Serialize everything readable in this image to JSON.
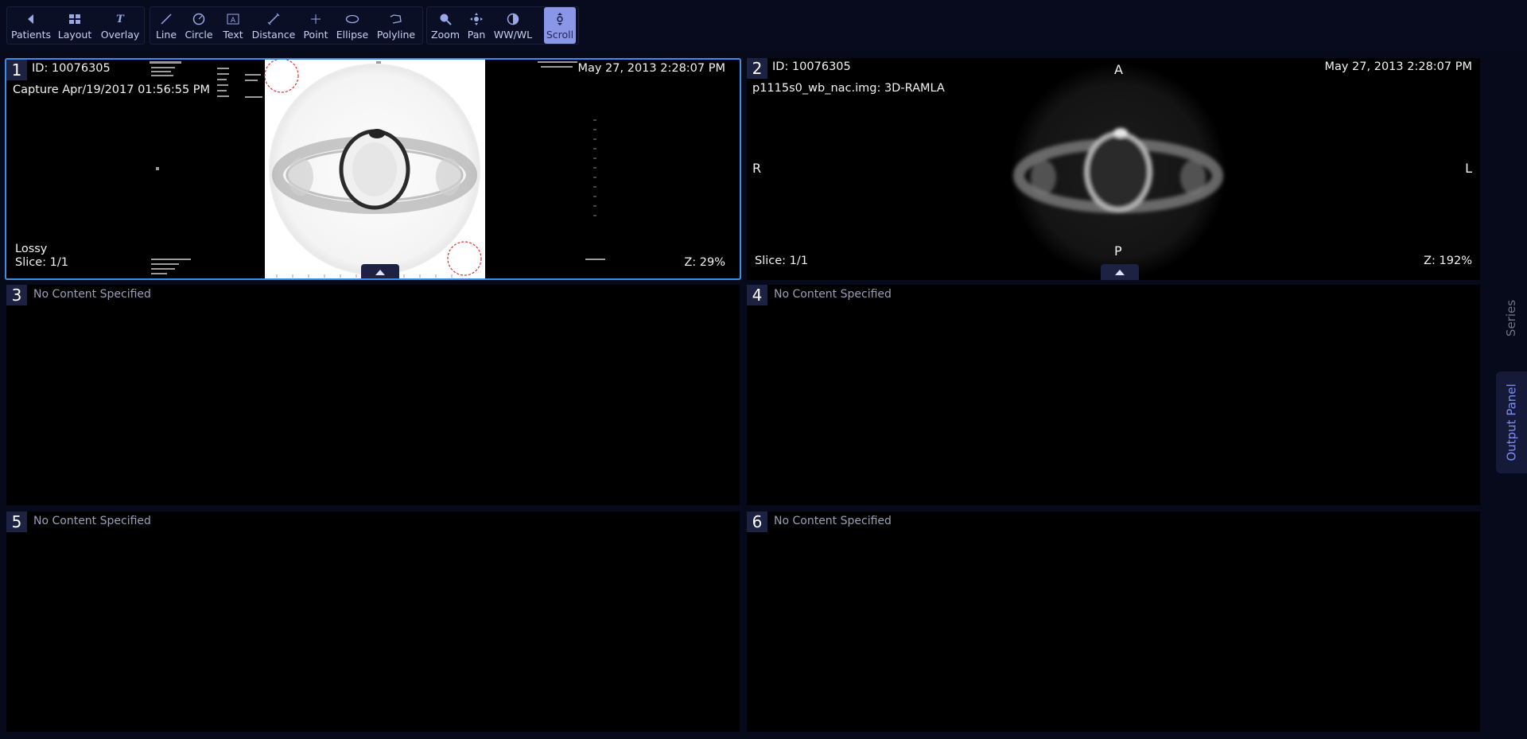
{
  "toolbar": {
    "nav": [
      {
        "label": "Patients",
        "icon": "chevron-left-icon"
      },
      {
        "label": "Layout",
        "icon": "grid-layout-icon"
      },
      {
        "label": "Overlay",
        "icon": "overlay-text-icon"
      }
    ],
    "tools": [
      {
        "label": "Line",
        "icon": "line-icon"
      },
      {
        "label": "Circle",
        "icon": "circle-icon"
      },
      {
        "label": "Text",
        "icon": "text-box-icon"
      },
      {
        "label": "Distance",
        "icon": "distance-icon"
      },
      {
        "label": "Point",
        "icon": "point-icon"
      },
      {
        "label": "Ellipse",
        "icon": "ellipse-icon"
      },
      {
        "label": "Polyline",
        "icon": "polyline-icon"
      }
    ],
    "view": [
      {
        "label": "Zoom",
        "icon": "zoom-icon"
      },
      {
        "label": "Pan",
        "icon": "pan-icon"
      },
      {
        "label": "WW/WL",
        "icon": "contrast-icon"
      },
      {
        "label": "Scroll",
        "icon": "scroll-icon",
        "active": true
      }
    ]
  },
  "viewports": [
    {
      "number": "1",
      "active": true,
      "id": "ID: 10076305",
      "date": "May 27, 2013 2:28:07 PM",
      "description": "Capture Apr/19/2017 01:56:55 PM",
      "compression": "Lossy",
      "slice": "Slice: 1/1",
      "zoom": "Z: 29%"
    },
    {
      "number": "2",
      "id": "ID: 10076305",
      "date": "May 27, 2013 2:28:07 PM",
      "description": "p1115s0_wb_nac.img: 3D-RAMLA",
      "slice": "Slice: 1/1",
      "zoom": "Z: 192%",
      "orientation": {
        "top": "A",
        "bottom": "P",
        "left": "R",
        "right": "L"
      }
    },
    {
      "number": "3",
      "empty_text": "No Content Specified"
    },
    {
      "number": "4",
      "empty_text": "No Content Specified"
    },
    {
      "number": "5",
      "empty_text": "No Content Specified"
    },
    {
      "number": "6",
      "empty_text": "No Content Specified"
    }
  ],
  "side_panel": {
    "series_label": "Series",
    "output_label": "Output Panel"
  },
  "colors": {
    "background": "#070a1a",
    "accent": "#8a96e6",
    "active_border": "#3e8ee6",
    "annotation_red": "#e0322f"
  }
}
